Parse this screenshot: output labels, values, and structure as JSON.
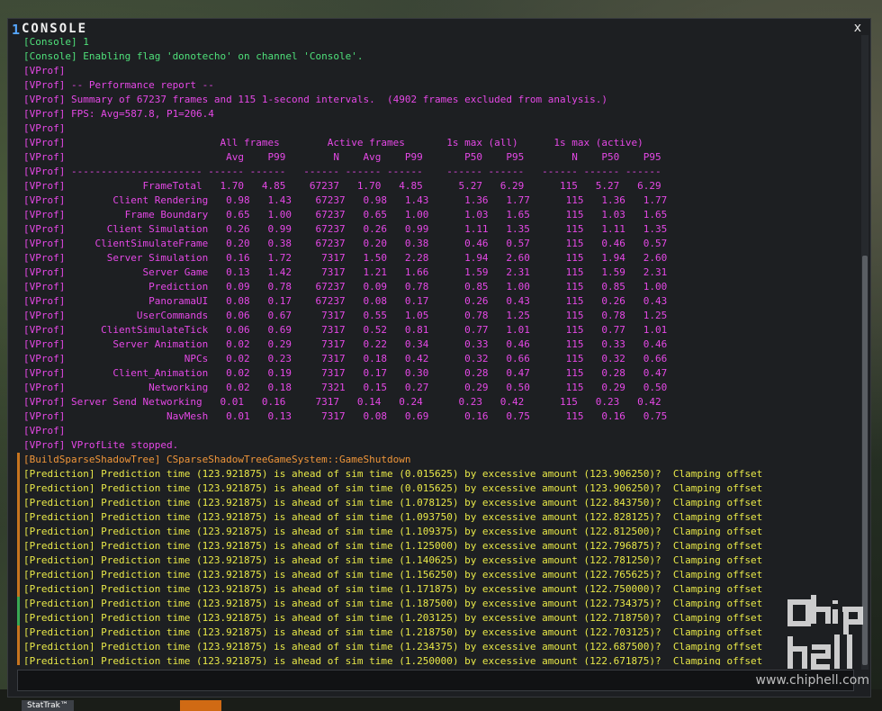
{
  "window": {
    "number": "1",
    "title": "CONSOLE",
    "close_label": "x"
  },
  "input": {
    "value": "",
    "placeholder": ""
  },
  "log": [
    {
      "kind": "con",
      "text": "[Console] 1"
    },
    {
      "kind": "con",
      "text": "[Console] Enabling flag 'donotecho' on channel 'Console'."
    },
    {
      "kind": "vp",
      "text": "[VProf]"
    },
    {
      "kind": "vp",
      "text": "[VProf] -- Performance report --"
    },
    {
      "kind": "vp",
      "text": "[VProf] Summary of 67237 frames and 115 1-second intervals.  (4902 frames excluded from analysis.)"
    },
    {
      "kind": "vp",
      "text": "[VProf] FPS: Avg=587.8, P1=206.4"
    },
    {
      "kind": "vp",
      "text": "[VProf]"
    },
    {
      "kind": "vp",
      "text": "[VProf]                          All frames        Active frames       1s max (all)      1s max (active)"
    },
    {
      "kind": "vp",
      "text": "[VProf]                           Avg    P99        N    Avg    P99       P50    P95        N    P50    P95"
    },
    {
      "kind": "vp",
      "text": "[VProf] ---------------------- ------ ------   ------ ------ ------    ------ ------   ------ ------ ------"
    },
    {
      "kind": "vp",
      "text": "[VProf]             FrameTotal   1.70   4.85    67237   1.70   4.85      5.27   6.29      115   5.27   6.29"
    },
    {
      "kind": "vp",
      "text": "[VProf]        Client Rendering   0.98   1.43    67237   0.98   1.43      1.36   1.77      115   1.36   1.77"
    },
    {
      "kind": "vp",
      "text": "[VProf]          Frame Boundary   0.65   1.00    67237   0.65   1.00      1.03   1.65      115   1.03   1.65"
    },
    {
      "kind": "vp",
      "text": "[VProf]       Client Simulation   0.26   0.99    67237   0.26   0.99      1.11   1.35      115   1.11   1.35"
    },
    {
      "kind": "vp",
      "text": "[VProf]     ClientSimulateFrame   0.20   0.38    67237   0.20   0.38      0.46   0.57      115   0.46   0.57"
    },
    {
      "kind": "vp",
      "text": "[VProf]       Server Simulation   0.16   1.72     7317   1.50   2.28      1.94   2.60      115   1.94   2.60"
    },
    {
      "kind": "vp",
      "text": "[VProf]             Server Game   0.13   1.42     7317   1.21   1.66      1.59   2.31      115   1.59   2.31"
    },
    {
      "kind": "vp",
      "text": "[VProf]              Prediction   0.09   0.78    67237   0.09   0.78      0.85   1.00      115   0.85   1.00"
    },
    {
      "kind": "vp",
      "text": "[VProf]              PanoramaUI   0.08   0.17    67237   0.08   0.17      0.26   0.43      115   0.26   0.43"
    },
    {
      "kind": "vp",
      "text": "[VProf]            UserCommands   0.06   0.67     7317   0.55   1.05      0.78   1.25      115   0.78   1.25"
    },
    {
      "kind": "vp",
      "text": "[VProf]      ClientSimulateTick   0.06   0.69     7317   0.52   0.81      0.77   1.01      115   0.77   1.01"
    },
    {
      "kind": "vp",
      "text": "[VProf]        Server Animation   0.02   0.29     7317   0.22   0.34      0.33   0.46      115   0.33   0.46"
    },
    {
      "kind": "vp",
      "text": "[VProf]                    NPCs   0.02   0.23     7317   0.18   0.42      0.32   0.66      115   0.32   0.66"
    },
    {
      "kind": "vp",
      "text": "[VProf]        Client_Animation   0.02   0.19     7317   0.17   0.30      0.28   0.47      115   0.28   0.47"
    },
    {
      "kind": "vp",
      "text": "[VProf]              Networking   0.02   0.18     7321   0.15   0.27      0.29   0.50      115   0.29   0.50"
    },
    {
      "kind": "vp",
      "text": "[VProf] Server Send Networking   0.01   0.16     7317   0.14   0.24      0.23   0.42      115   0.23   0.42"
    },
    {
      "kind": "vp",
      "text": "[VProf]                 NavMesh   0.01   0.13     7317   0.08   0.69      0.16   0.75      115   0.16   0.75"
    },
    {
      "kind": "vp",
      "text": "[VProf]"
    },
    {
      "kind": "vp",
      "text": "[VProf] VProfLite stopped."
    },
    {
      "kind": "bst",
      "text": "[BuildSparseShadowTree] CSparseShadowTreeGameSystem::GameShutdown"
    },
    {
      "kind": "pred",
      "text": "[Prediction] Prediction time (123.921875) is ahead of sim time (0.015625) by excessive amount (123.906250)?  Clamping offset"
    },
    {
      "kind": "pred",
      "text": "[Prediction] Prediction time (123.921875) is ahead of sim time (0.015625) by excessive amount (123.906250)?  Clamping offset"
    },
    {
      "kind": "pred",
      "text": "[Prediction] Prediction time (123.921875) is ahead of sim time (1.078125) by excessive amount (122.843750)?  Clamping offset"
    },
    {
      "kind": "pred",
      "text": "[Prediction] Prediction time (123.921875) is ahead of sim time (1.093750) by excessive amount (122.828125)?  Clamping offset"
    },
    {
      "kind": "pred",
      "text": "[Prediction] Prediction time (123.921875) is ahead of sim time (1.109375) by excessive amount (122.812500)?  Clamping offset"
    },
    {
      "kind": "pred",
      "text": "[Prediction] Prediction time (123.921875) is ahead of sim time (1.125000) by excessive amount (122.796875)?  Clamping offset"
    },
    {
      "kind": "pred",
      "text": "[Prediction] Prediction time (123.921875) is ahead of sim time (1.140625) by excessive amount (122.781250)?  Clamping offset"
    },
    {
      "kind": "pred",
      "text": "[Prediction] Prediction time (123.921875) is ahead of sim time (1.156250) by excessive amount (122.765625)?  Clamping offset"
    },
    {
      "kind": "pred",
      "text": "[Prediction] Prediction time (123.921875) is ahead of sim time (1.171875) by excessive amount (122.750000)?  Clamping offset"
    },
    {
      "kind": "pred",
      "text": "[Prediction] Prediction time (123.921875) is ahead of sim time (1.187500) by excessive amount (122.734375)?  Clamping offset"
    },
    {
      "kind": "pred",
      "text": "[Prediction] Prediction time (123.921875) is ahead of sim time (1.203125) by excessive amount (122.718750)?  Clamping offset"
    },
    {
      "kind": "pred",
      "text": "[Prediction] Prediction time (123.921875) is ahead of sim time (1.218750) by excessive amount (122.703125)?  Clamping offset"
    },
    {
      "kind": "pred",
      "text": "[Prediction] Prediction time (123.921875) is ahead of sim time (1.234375) by excessive amount (122.687500)?  Clamping offset"
    },
    {
      "kind": "pred",
      "text": "[Prediction] Prediction time (123.921875) is ahead of sim time (1.250000) by excessive amount (122.671875)?  Clamping offset"
    }
  ],
  "watermark": "www.chiphell.com",
  "hud": {
    "stattrak_label": "StatTrak™"
  },
  "colors": {
    "console_green": "#4fe07a",
    "vprof_magenta": "#e548e6",
    "buildshadow_orange": "#f0963a",
    "prediction_yellow": "#e8e848",
    "title_accent": "#56a6ff"
  }
}
